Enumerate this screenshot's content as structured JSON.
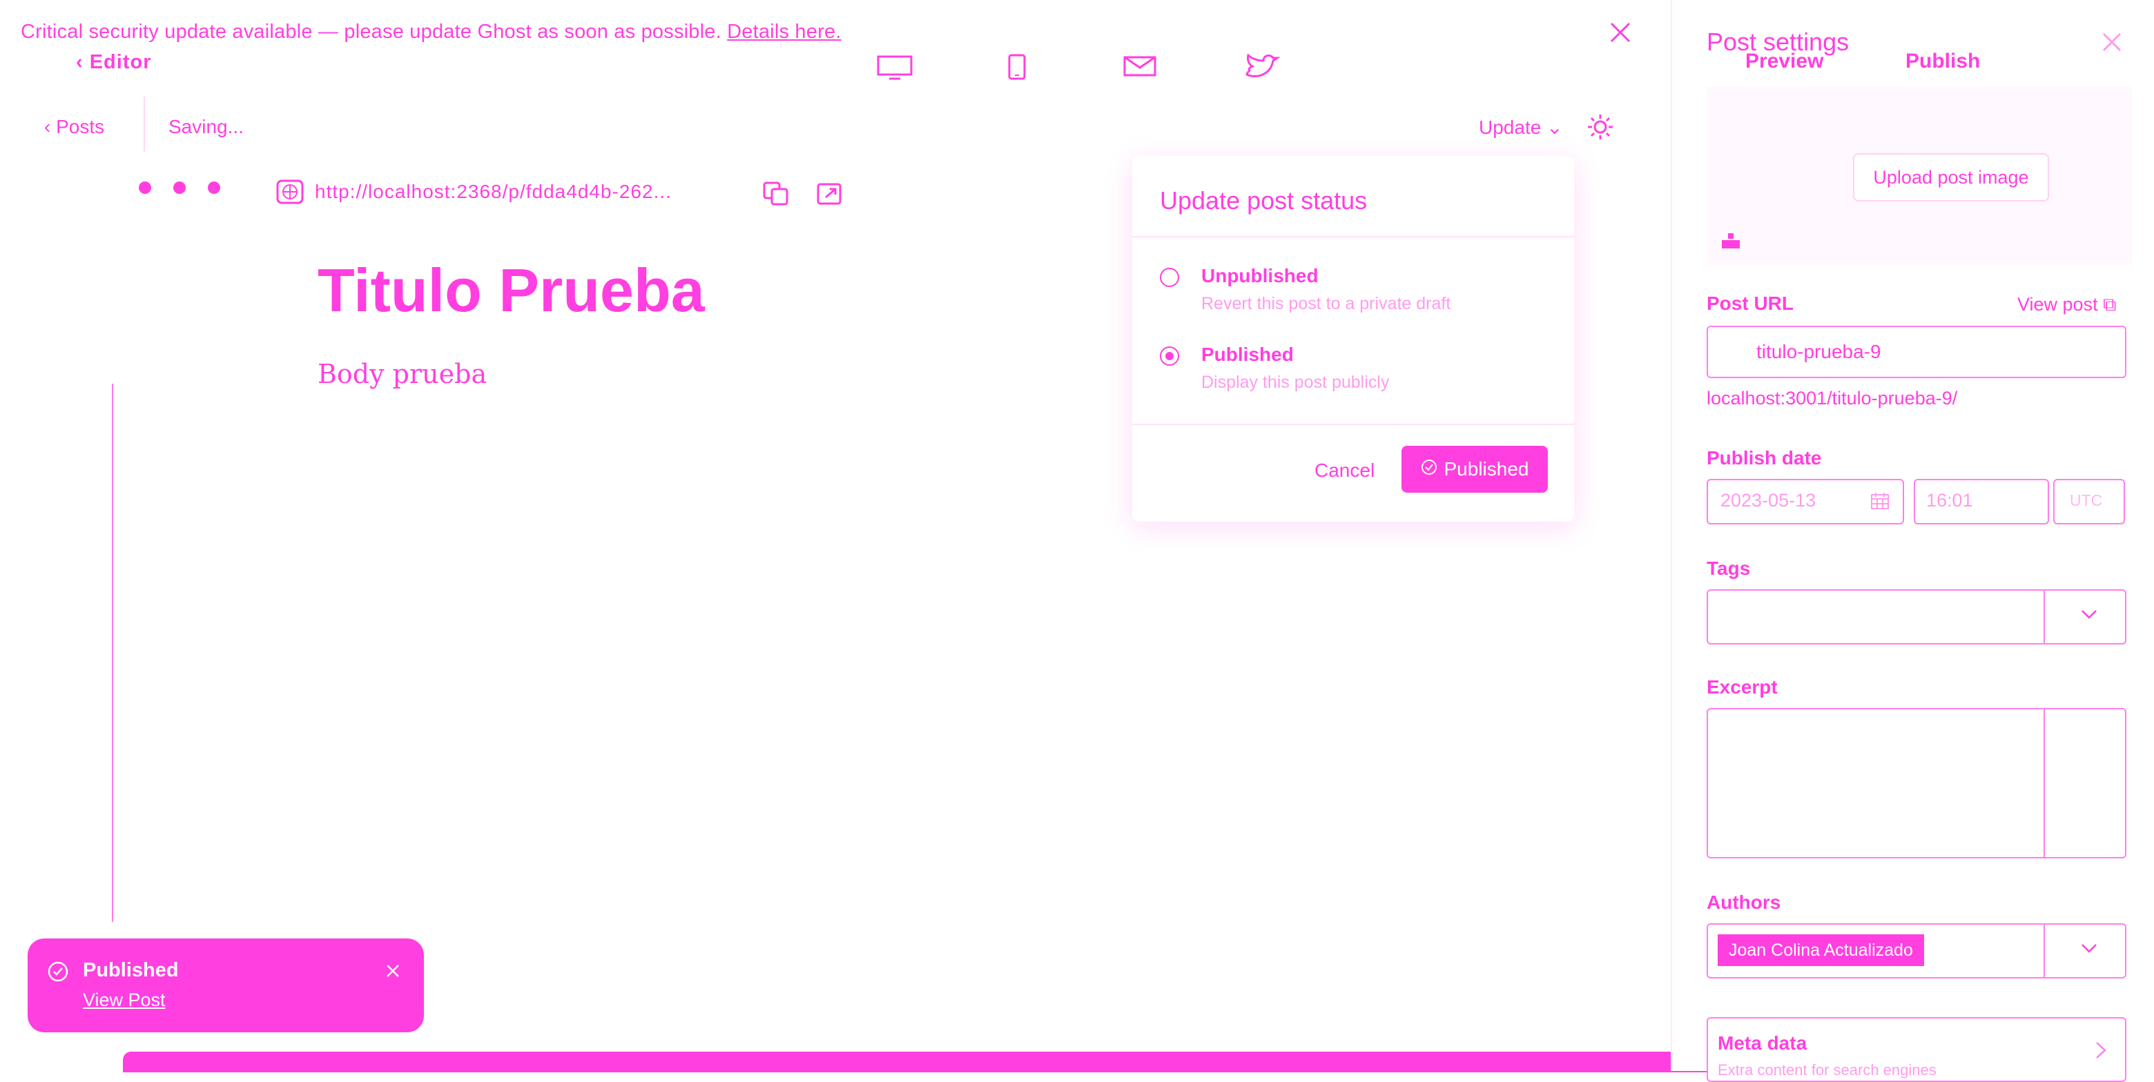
{
  "banner": {
    "text": "Critical security update available — please update Ghost as soon as possible.",
    "link": "Details here."
  },
  "header": {
    "back_label": "Editor",
    "posts_label": "Posts",
    "saving_status": "Saving...",
    "update_label": "Update"
  },
  "preview": {
    "url_text": "http://localhost:2368/p/fdda4d4b-262..."
  },
  "post": {
    "title": "Titulo Prueba",
    "body": "Body prueba"
  },
  "popover": {
    "title": "Update post status",
    "options": [
      {
        "label": "Unpublished",
        "description": "Revert this post to a private draft",
        "selected": false
      },
      {
        "label": "Published",
        "description": "Display this post publicly",
        "selected": true
      }
    ],
    "cancel_label": "Cancel",
    "confirm_label": "Published"
  },
  "toast": {
    "title": "Published",
    "link": "View Post"
  },
  "sidebar": {
    "title": "Post settings",
    "tabs": [
      "Preview",
      "Publish"
    ],
    "upload_label": "Upload post image",
    "post_url_label": "Post URL",
    "view_post_label": "View post",
    "slug": "titulo-prueba-9",
    "full_url": "localhost:3001/titulo-prueba-9/",
    "publish_date_label": "Publish date",
    "date_value": "2023-05-13",
    "time_value": "16:01",
    "timezone": "UTC",
    "tags_label": "Tags",
    "excerpt_label": "Excerpt",
    "authors_label": "Authors",
    "author_name": "Joan Colina Actualizado",
    "meta_title": "Meta data",
    "meta_subtitle": "Extra content for search engines"
  },
  "colors": {
    "accent": "#ff3fe0",
    "light_accent": "#ff9bee"
  }
}
